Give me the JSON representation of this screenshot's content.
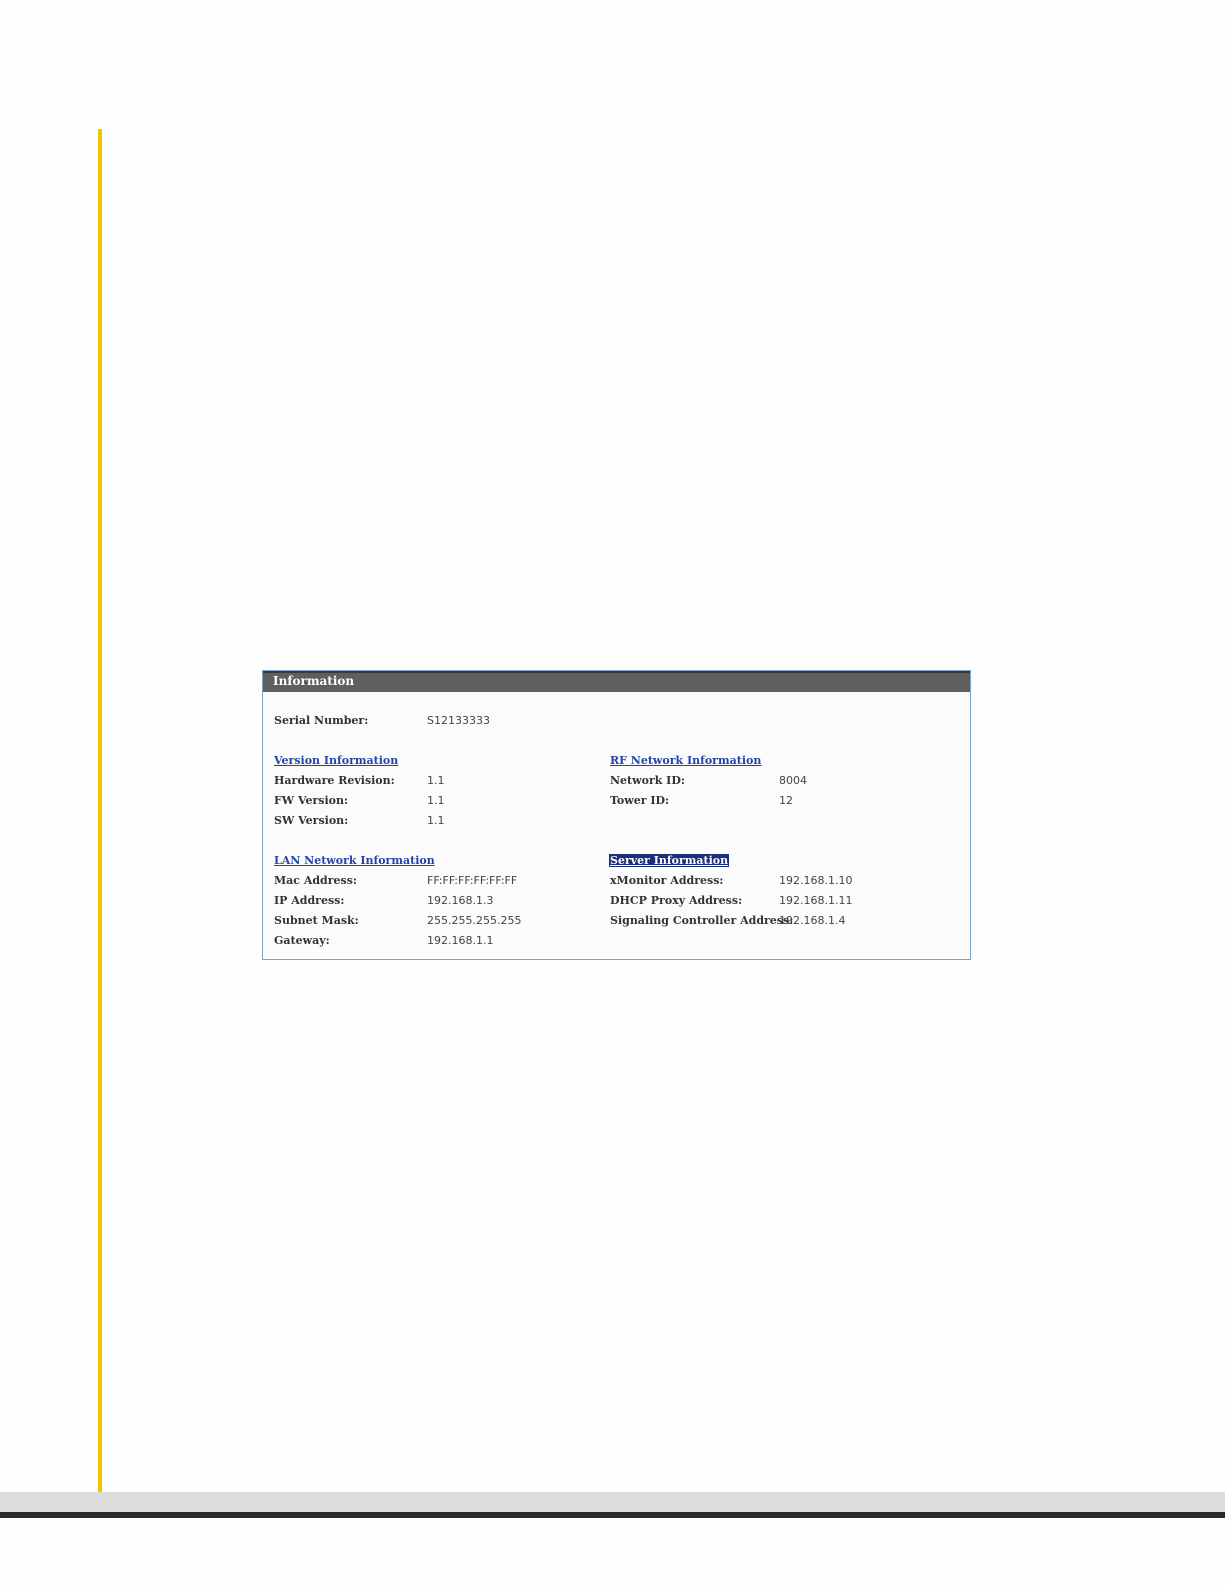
{
  "colors": {
    "accent_rule": "#f2c300",
    "panel_header_bg": "#5f5f5f",
    "panel_border": "#7fa3c8",
    "link": "#2244aa",
    "selected_link_bg": "#1c2e7a"
  },
  "panel": {
    "title": "Information",
    "serial": {
      "label": "Serial Number:",
      "value": "S12133333"
    },
    "version": {
      "heading": "Version Information",
      "rows": [
        {
          "label": "Hardware Revision:",
          "value": "1.1"
        },
        {
          "label": "FW Version:",
          "value": "1.1"
        },
        {
          "label": "SW Version:",
          "value": "1.1"
        }
      ]
    },
    "rf": {
      "heading": "RF Network Information",
      "rows": [
        {
          "label": "Network ID:",
          "value": "8004"
        },
        {
          "label": "Tower ID:",
          "value": "12"
        }
      ]
    },
    "lan": {
      "heading": "LAN Network Information",
      "rows": [
        {
          "label": "Mac Address:",
          "value": "FF:FF:FF:FF:FF:FF"
        },
        {
          "label": "IP Address:",
          "value": "192.168.1.3"
        },
        {
          "label": "Subnet Mask:",
          "value": "255.255.255.255"
        },
        {
          "label": "Gateway:",
          "value": "192.168.1.1"
        }
      ]
    },
    "server": {
      "heading": "Server Information",
      "selected": true,
      "rows": [
        {
          "label": "xMonitor Address:",
          "value": "192.168.1.10"
        },
        {
          "label": "DHCP Proxy Address:",
          "value": "192.168.1.11"
        },
        {
          "label": "Signaling Controller Address:",
          "value": "192.168.1.4"
        }
      ]
    }
  }
}
